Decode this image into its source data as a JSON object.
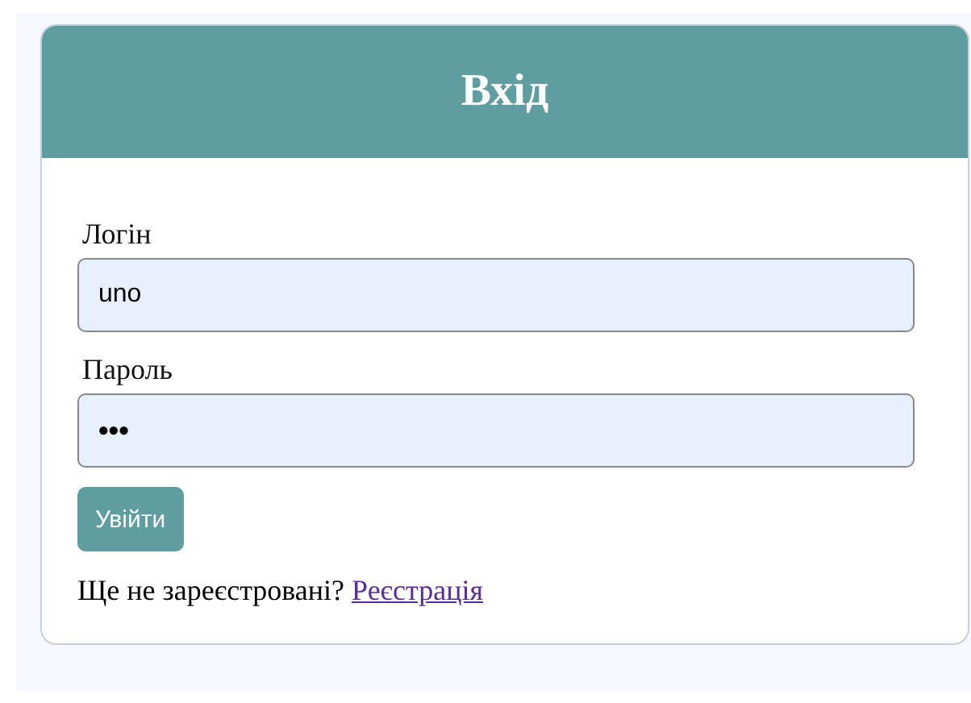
{
  "header": {
    "title": "Вхід"
  },
  "fields": [
    {
      "label": "Логін",
      "value": "uno",
      "kind": "text"
    },
    {
      "label": "Пароль",
      "value": "•••",
      "kind": "password"
    }
  ],
  "submit_button": "Увійти",
  "footer": {
    "text": "Ще не зареєстровані?",
    "link": "Реєстрація"
  }
}
